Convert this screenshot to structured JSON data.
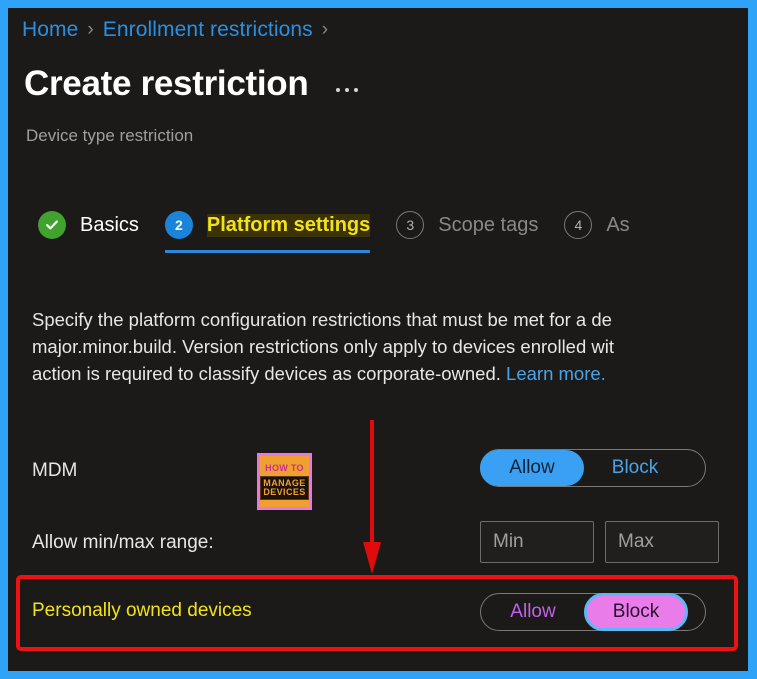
{
  "frame": {
    "accent_border_color": "#2fa3f7",
    "background": "#1b1a19"
  },
  "breadcrumb": {
    "items": [
      {
        "label": "Home"
      },
      {
        "label": "Enrollment restrictions"
      }
    ],
    "separator": "›",
    "trailing_separator": "›"
  },
  "header": {
    "title": "Create restriction",
    "subtitle": "Device type restriction",
    "more_menu": "more-options"
  },
  "wizard": {
    "steps": [
      {
        "badge": "✓",
        "label": "Basics",
        "state": "completed"
      },
      {
        "badge": "2",
        "label": "Platform settings",
        "state": "active"
      },
      {
        "badge": "3",
        "label": "Scope tags",
        "state": "todo"
      },
      {
        "badge": "4",
        "label": "As",
        "state": "todo"
      }
    ]
  },
  "main": {
    "description_line1": "Specify the platform configuration restrictions that must be met for a de",
    "description_line2": "major.minor.build. Version restrictions only apply to devices enrolled wit",
    "description_line3": "action is required to classify devices as corporate-owned. ",
    "learn_more": "Learn more.",
    "settings": [
      {
        "label": "MDM",
        "control": "toggle",
        "options": [
          "Allow",
          "Block"
        ],
        "selected": "Allow",
        "selected_color": "#3aa0f3"
      },
      {
        "label": "Allow min/max range:",
        "control": "text-inputs",
        "min_placeholder": "Min",
        "min_value": "",
        "max_placeholder": "Max",
        "max_value": ""
      },
      {
        "label": "Personally owned devices",
        "control": "toggle",
        "options": [
          "Allow",
          "Block"
        ],
        "selected": "Block",
        "selected_color": "#e97ce8",
        "highlighted": true,
        "highlight_color": "#ee1111",
        "label_color": "#f2e317"
      }
    ]
  },
  "annotations": {
    "arrow": {
      "name": "red-down-arrow",
      "color": "#e00b0b"
    },
    "watermark": {
      "line1": "HOW TO",
      "line2": "MANAGE",
      "line3": "DEVICES"
    }
  }
}
